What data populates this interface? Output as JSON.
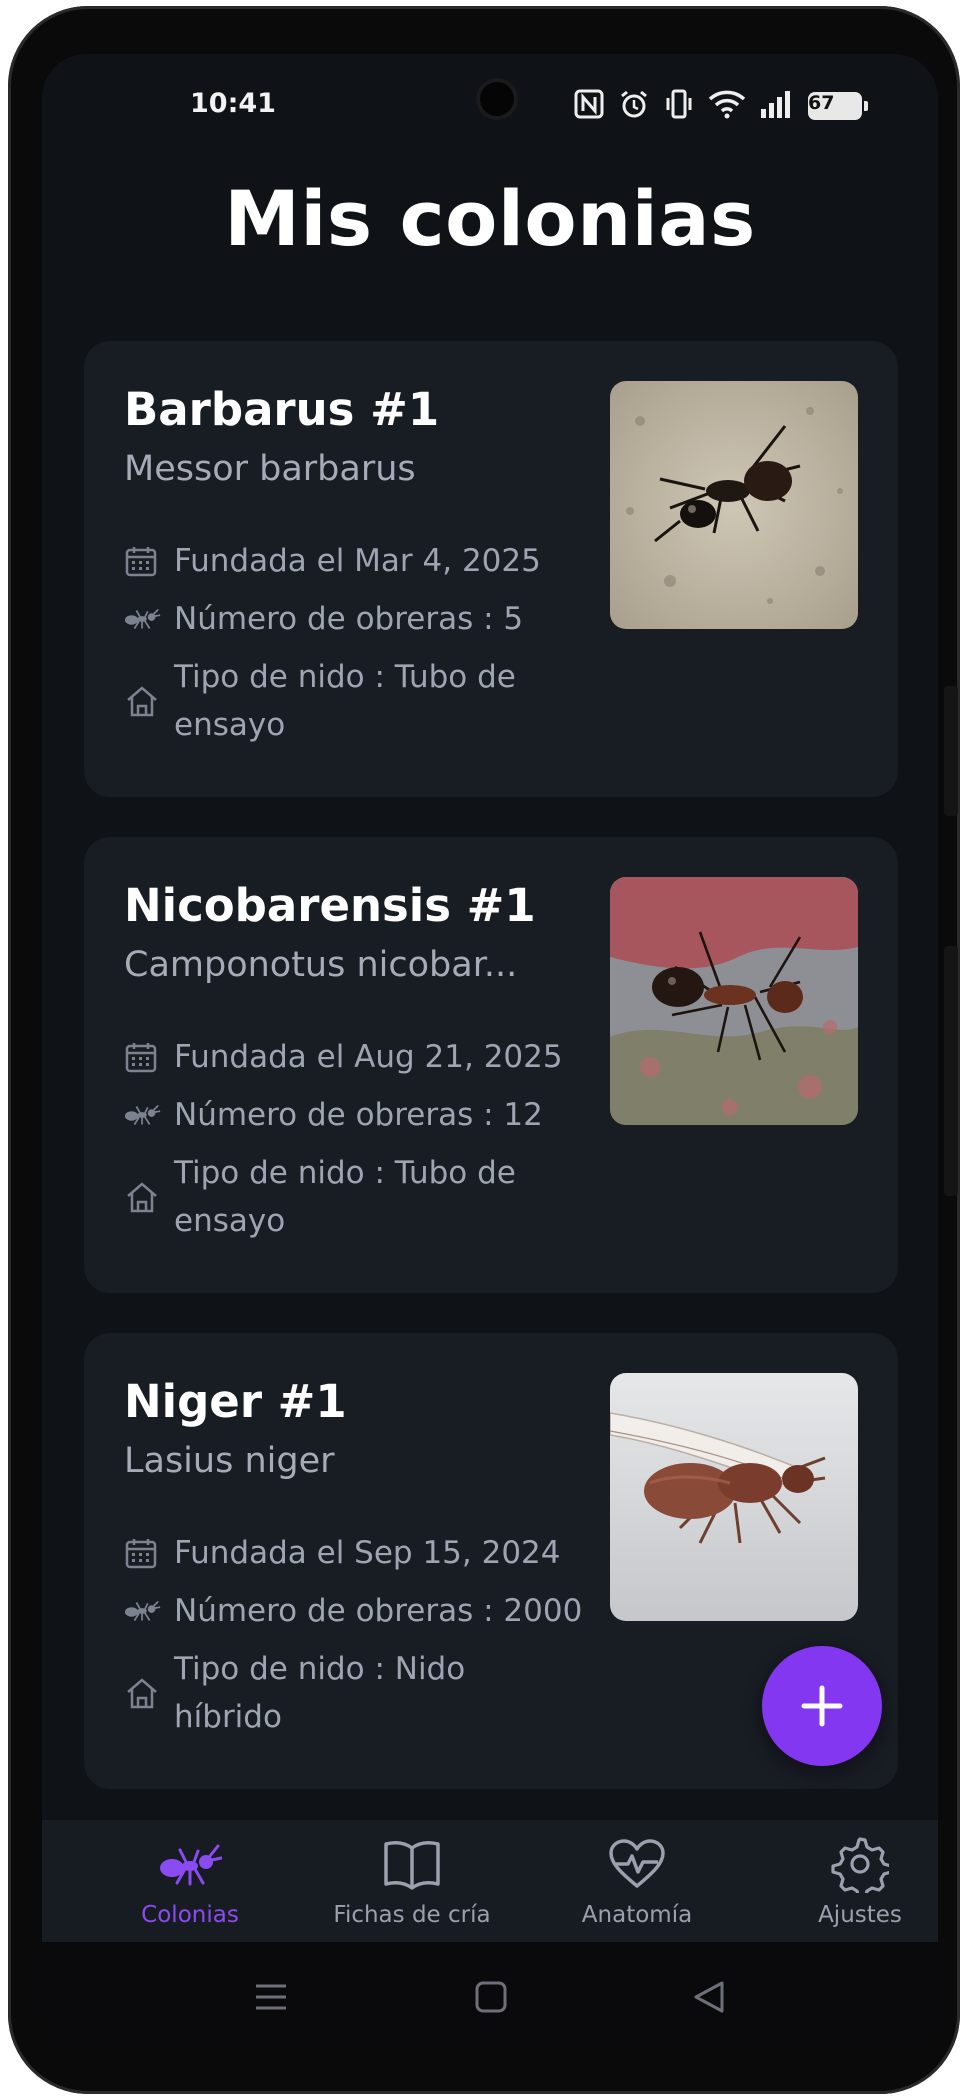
{
  "status_bar": {
    "time": "10:41",
    "battery": "67",
    "icons": [
      "nfc-icon",
      "alarm-icon",
      "vibrate-icon",
      "wifi-icon",
      "signal-icon",
      "battery-icon"
    ]
  },
  "page": {
    "title": "Mis colonias"
  },
  "colonies": [
    {
      "name": "Barbarus #1",
      "species": "Messor barbarus",
      "founded": "Fundada el Mar 4, 2025",
      "workers": "Número de obreras : 5",
      "nest_line1": "Tipo de nido : Tubo de",
      "nest_line2": "ensayo",
      "photo": "black-ant-photo"
    },
    {
      "name": "Nicobarensis #1",
      "species": "Camponotus nicobar...",
      "founded": "Fundada el Aug 21, 2025",
      "workers": "Número de obreras : 12",
      "nest_line1": "Tipo de nido : Tubo de",
      "nest_line2": "ensayo",
      "photo": "red-black-ant-photo"
    },
    {
      "name": "Niger #1",
      "species": "Lasius niger",
      "founded": "Fundada el Sep 15, 2024",
      "workers": "Número de obreras : 2000",
      "nest_line1": "Tipo de nido : Nido",
      "nest_line2": "híbrido",
      "photo": "winged-queen-ant-photo"
    }
  ],
  "fab": {
    "icon": "plus-icon"
  },
  "bottom_nav": [
    {
      "label": "Colonias",
      "icon": "ant-icon",
      "active": true
    },
    {
      "label": "Fichas de cría",
      "icon": "book-icon",
      "active": false
    },
    {
      "label": "Anatomía",
      "icon": "heart-pulse-icon",
      "active": false
    },
    {
      "label": "Ajustes",
      "icon": "gear-icon",
      "active": false
    }
  ],
  "colors": {
    "accent": "#8437f0",
    "background": "#0f1217",
    "card": "#181c23",
    "text_muted": "#9ea4b1"
  }
}
